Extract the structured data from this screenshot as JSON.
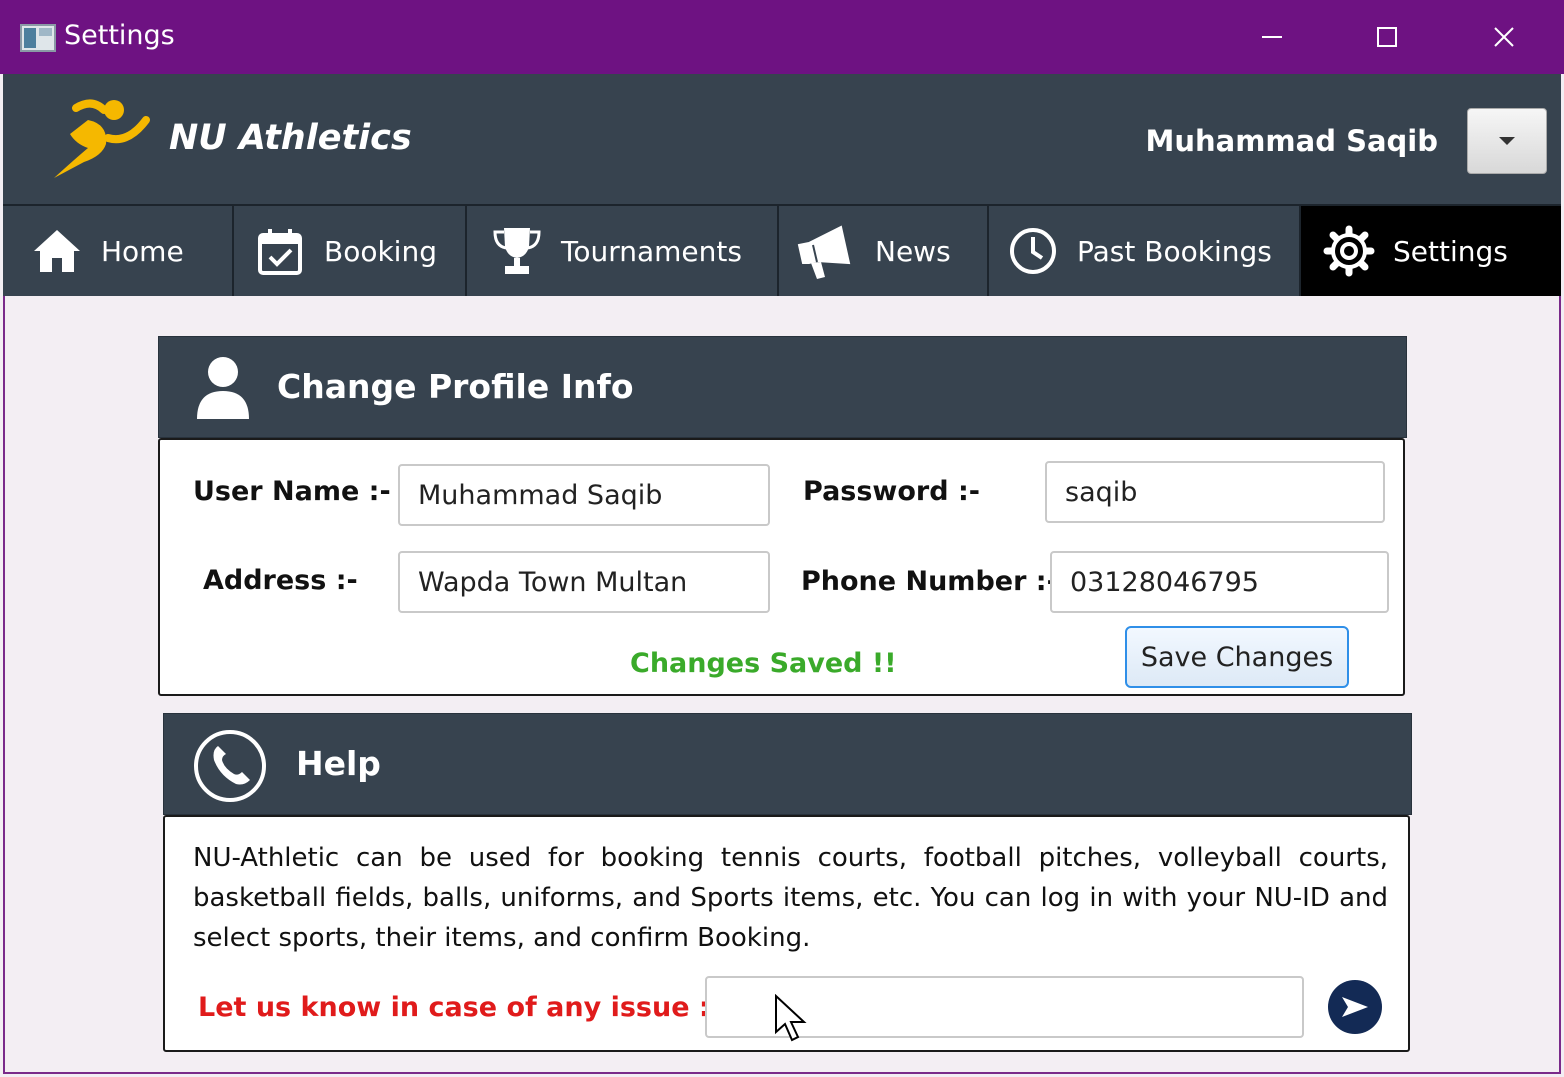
{
  "window": {
    "title": "Settings"
  },
  "header": {
    "brand": "NU Athletics",
    "user_name": "Muhammad Saqib"
  },
  "nav": {
    "tabs": [
      {
        "label": "Home",
        "icon": "home-icon"
      },
      {
        "label": "Booking",
        "icon": "calendar-check-icon"
      },
      {
        "label": "Tournaments",
        "icon": "trophy-icon"
      },
      {
        "label": "News",
        "icon": "megaphone-icon"
      },
      {
        "label": "Past Bookings",
        "icon": "clock-icon"
      },
      {
        "label": "Settings",
        "icon": "gear-icon",
        "active": true
      }
    ]
  },
  "profile": {
    "title": "Change Profile Info",
    "user_name_label": "User Name :-",
    "user_name_value": "Muhammad Saqib",
    "password_label": "Password :-",
    "password_value": "saqib",
    "address_label": "Address :-",
    "address_value": "Wapda Town Multan",
    "phone_label": "Phone Number :-",
    "phone_value": "03128046795",
    "status_message": "Changes Saved !!",
    "save_label": "Save Changes"
  },
  "help": {
    "title": "Help",
    "text": "NU-Athletic can be used for booking tennis courts, football pitches, volleyball courts, basketball fields, balls, uniforms, and Sports items, etc. You can log in with your NU-ID and select sports, their items, and confirm Booking.",
    "issue_label": "Let us know in case of any issue :-",
    "issue_value": ""
  },
  "colors": {
    "titlebar": "#6e1282",
    "header": "#37434f",
    "active_tab": "#000000",
    "success": "#3aaa2a",
    "alert": "#e01b1b",
    "send_button": "#132a55",
    "logo": "#f5b800"
  }
}
